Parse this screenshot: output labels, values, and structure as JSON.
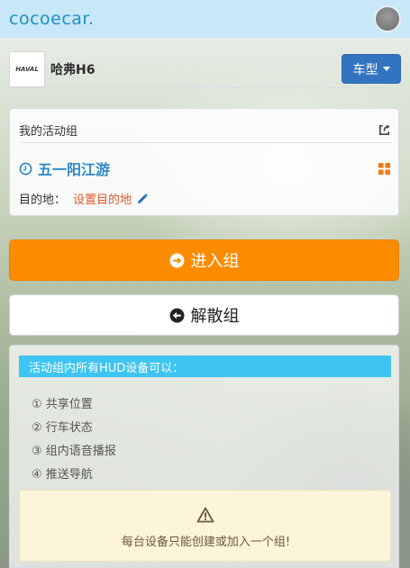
{
  "header": {
    "logo_text": "cocoecar.",
    "avatar_label": ""
  },
  "car": {
    "brand_logo_text": "HAVAL",
    "name": "哈弗H6",
    "type_button_label": "车型"
  },
  "activity_group": {
    "section_title": "我的活动组",
    "group_name": "五一阳江游",
    "destination_label": "目的地：",
    "destination_link": "设置目的地"
  },
  "actions": {
    "enter_label": "进入组",
    "dissolve_label": "解散组"
  },
  "info": {
    "heading": "活动组内所有HUD设备可以：",
    "features": [
      "① 共享位置",
      "② 行车状态",
      "③ 组内语音播报",
      "④ 推送导航"
    ],
    "warning_text": "每台设备只能创建或加入一个组!"
  },
  "colors": {
    "accent_orange": "#fb8c00",
    "accent_blue": "#3274c0",
    "header_bg": "#c9e8f7",
    "info_heading_bg": "#3ec4f2",
    "group_name": "#2e87c8",
    "destination_link": "#e3572b"
  },
  "icons": {
    "share": "share-external-icon",
    "clock": "clock-icon",
    "grid": "grid-icon",
    "pencil": "pencil-icon",
    "enter": "arrow-right-circle-icon",
    "dissolve": "arrow-left-circle-icon",
    "warning": "warning-triangle-icon"
  }
}
